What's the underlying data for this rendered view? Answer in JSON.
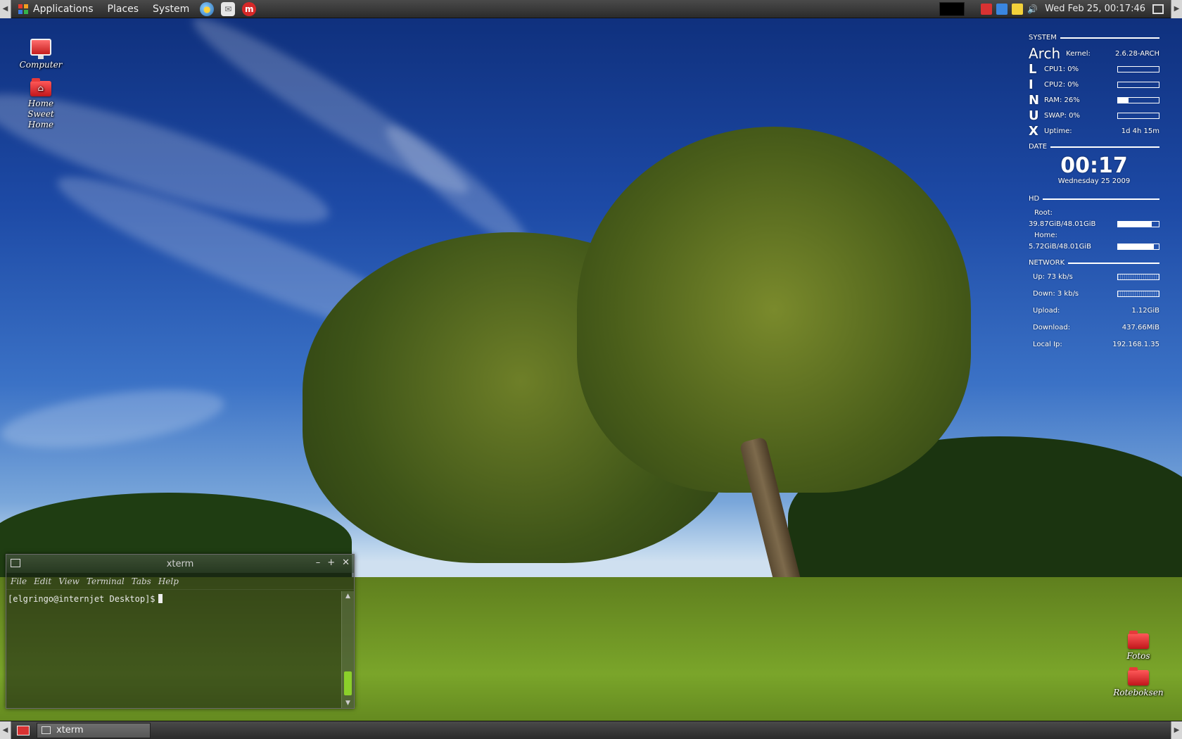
{
  "top_panel": {
    "menus": [
      "Applications",
      "Places",
      "System"
    ],
    "launchers": [
      "web-browser-icon",
      "mail-icon",
      "m-app-icon"
    ],
    "clock": "Wed Feb 25, 00:17:46"
  },
  "desktop": {
    "icons_left": [
      {
        "label": "Computer"
      },
      {
        "label": "Home Sweet Home"
      }
    ],
    "icons_right": [
      {
        "label": "Fotos"
      },
      {
        "label": "Roteboksen"
      }
    ]
  },
  "conky": {
    "system": {
      "heading": "SYSTEM",
      "distro": "Arch",
      "kernel_label": "Kernel:",
      "kernel": "2.6.28-ARCH",
      "letters": [
        "L",
        "I",
        "N",
        "U",
        "X"
      ],
      "cpu1": "CPU1: 0%",
      "cpu2": "CPU2: 0%",
      "ram": "RAM: 26%",
      "swap": "SWAP: 0%",
      "uptime_label": "Uptime:",
      "uptime": "1d 4h 15m",
      "levels": {
        "cpu1": 0,
        "cpu2": 0,
        "ram": 0.26,
        "swap": 0
      }
    },
    "date": {
      "heading": "DATE",
      "time": "00:17",
      "date": "Wednesday 25 2009"
    },
    "hd": {
      "heading": "HD",
      "root_label": "Root:",
      "root": "39.87GiB/48.01GiB",
      "home_label": "Home:",
      "home": "5.72GiB/48.01GiB",
      "levels": {
        "root": 0.83,
        "home": 0.88
      }
    },
    "network": {
      "heading": "NETWORK",
      "up": "Up: 73 kb/s",
      "down": "Down: 3 kb/s",
      "upload_label": "Upload:",
      "upload": "1.12GiB",
      "download_label": "Download:",
      "download": "437.66MiB",
      "ip_label": "Local Ip:",
      "ip": "192.168.1.35"
    }
  },
  "xterm": {
    "title": "xterm",
    "menu": [
      "File",
      "Edit",
      "View",
      "Terminal",
      "Tabs",
      "Help"
    ],
    "prompt": "[elgringo@internjet Desktop]$"
  },
  "taskbar": {
    "tasks": [
      {
        "label": "xterm"
      }
    ]
  }
}
